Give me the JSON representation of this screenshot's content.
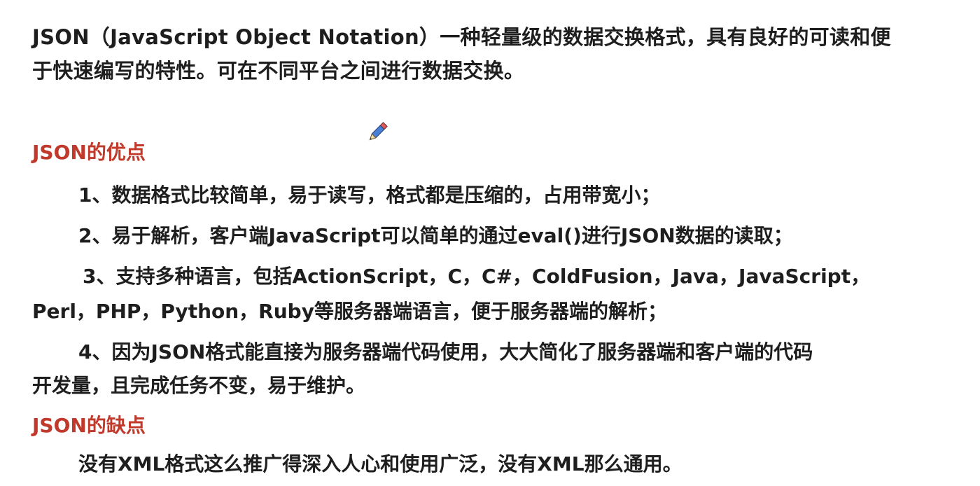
{
  "intro": {
    "line1": "JSON（JavaScript Object Notation）一种轻量级的数据交换格式，具有良好的可读和便",
    "line2": "于快速编写的特性。可在不同平台之间进行数据交换。"
  },
  "advantages": {
    "heading": "JSON的优点",
    "items": [
      {
        "line1": "1、数据格式比较简单，易于读写，格式都是压缩的，占用带宽小；"
      },
      {
        "line1": "2、易于解析，客户端JavaScript可以简单的通过eval()进行JSON数据的读取；"
      },
      {
        "line1": "3、支持多种语言，包括ActionScript，C，C#，ColdFusion，Java，JavaScript，",
        "line2": "Perl，PHP，Python，Ruby等服务器端语言，便于服务器端的解析；"
      },
      {
        "line1": "4、因为JSON格式能直接为服务器端代码使用，大大简化了服务器端和客户端的代码",
        "line2": "开发量，且完成任务不变，易于维护。"
      }
    ]
  },
  "disadvantages": {
    "heading": "JSON的缺点",
    "items": [
      {
        "line1": "没有XML格式这么推广得深入人心和使用广泛，没有XML那么通用。"
      }
    ]
  },
  "icons": {
    "cursor": "pencil-icon"
  },
  "colors": {
    "heading": "#c0392b",
    "text": "#1e1e1e",
    "background": "#ffffff"
  }
}
